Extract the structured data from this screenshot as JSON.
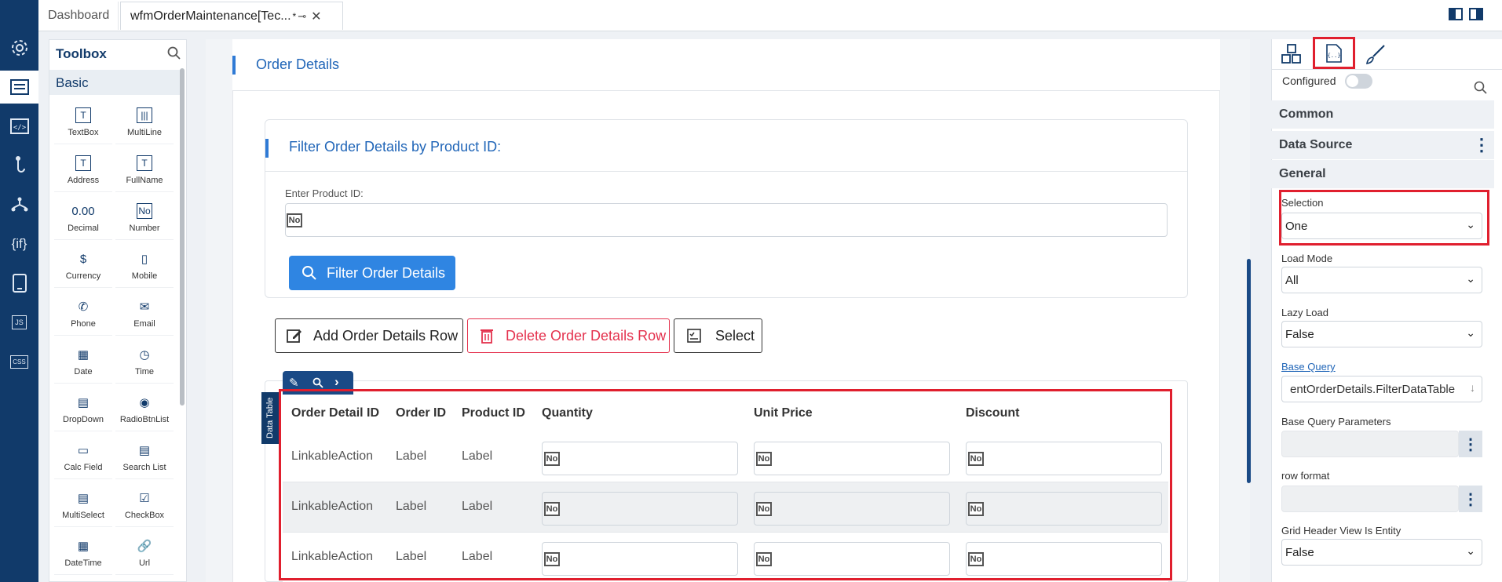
{
  "tabs": {
    "dashboard": "Dashboard",
    "active": "wfmOrderMaintenance[Tec...",
    "active_marker": "*"
  },
  "nav": {
    "icons": [
      "gear-icon",
      "form-icon",
      "code-icon",
      "hook-icon",
      "flow-icon",
      "if-icon",
      "tablet-icon",
      "js-icon",
      "css-icon"
    ],
    "if_text": "{if}",
    "js_text": "JS",
    "css_text": "CSS"
  },
  "toolbox": {
    "title": "Toolbox",
    "section": "Basic",
    "items": [
      {
        "label": "TextBox",
        "glyph": "T"
      },
      {
        "label": "MultiLine",
        "glyph": "|||"
      },
      {
        "label": "Address",
        "glyph": "T"
      },
      {
        "label": "FullName",
        "glyph": "T"
      },
      {
        "label": "Decimal",
        "glyph": "0.00"
      },
      {
        "label": "Number",
        "glyph": "No"
      },
      {
        "label": "Currency",
        "glyph": "$"
      },
      {
        "label": "Mobile",
        "glyph": "▯"
      },
      {
        "label": "Phone",
        "glyph": "✆"
      },
      {
        "label": "Email",
        "glyph": "✉"
      },
      {
        "label": "Date",
        "glyph": "▦"
      },
      {
        "label": "Time",
        "glyph": "◷"
      },
      {
        "label": "DropDown",
        "glyph": "▤"
      },
      {
        "label": "RadioBtnList",
        "glyph": "◉"
      },
      {
        "label": "Calc Field",
        "glyph": "▭"
      },
      {
        "label": "Search List",
        "glyph": "▤"
      },
      {
        "label": "MultiSelect",
        "glyph": "▤"
      },
      {
        "label": "CheckBox",
        "glyph": "☑"
      },
      {
        "label": "DateTime",
        "glyph": "▦"
      },
      {
        "label": "Url",
        "glyph": "🔗"
      }
    ]
  },
  "page": {
    "title": "Order Details",
    "filter": {
      "title": "Filter Order Details by Product ID:",
      "field_label": "Enter Product ID:",
      "no_badge": "No",
      "button": "Filter Order Details"
    },
    "actions": {
      "add": "Add Order Details Row",
      "delete": "Delete Order Details Row",
      "select": "Select"
    },
    "grid": {
      "tag": "Data Table",
      "columns": [
        "Order Detail ID",
        "Order ID",
        "Product ID",
        "Quantity",
        "Unit Price",
        "Discount"
      ],
      "rows": [
        {
          "c1": "LinkableAction",
          "c2": "Label",
          "c3": "Label",
          "badge": "No"
        },
        {
          "c1": "LinkableAction",
          "c2": "Label",
          "c3": "Label",
          "badge": "No"
        },
        {
          "c1": "LinkableAction",
          "c2": "Label",
          "c3": "Label",
          "badge": "No"
        }
      ]
    }
  },
  "props": {
    "configured_label": "Configured",
    "configured": false,
    "sections": {
      "common": "Common",
      "datasource": "Data Source",
      "general": "General"
    },
    "selection": {
      "label": "Selection",
      "value": "One"
    },
    "load_mode": {
      "label": "Load Mode",
      "value": "All"
    },
    "lazy_load": {
      "label": "Lazy Load",
      "value": "False"
    },
    "base_query": {
      "label": "Base Query",
      "value": "entOrderDetails.FilterDataTable"
    },
    "base_query_params": {
      "label": "Base Query Parameters",
      "value": ""
    },
    "row_format": {
      "label": "row format",
      "value": ""
    },
    "grid_header": {
      "label": "Grid Header View Is Entity",
      "value": "False"
    }
  },
  "colors": {
    "accent": "#2f85e2",
    "nav": "#113a6a",
    "highlight": "#e01f2e",
    "danger": "#e4314d"
  }
}
